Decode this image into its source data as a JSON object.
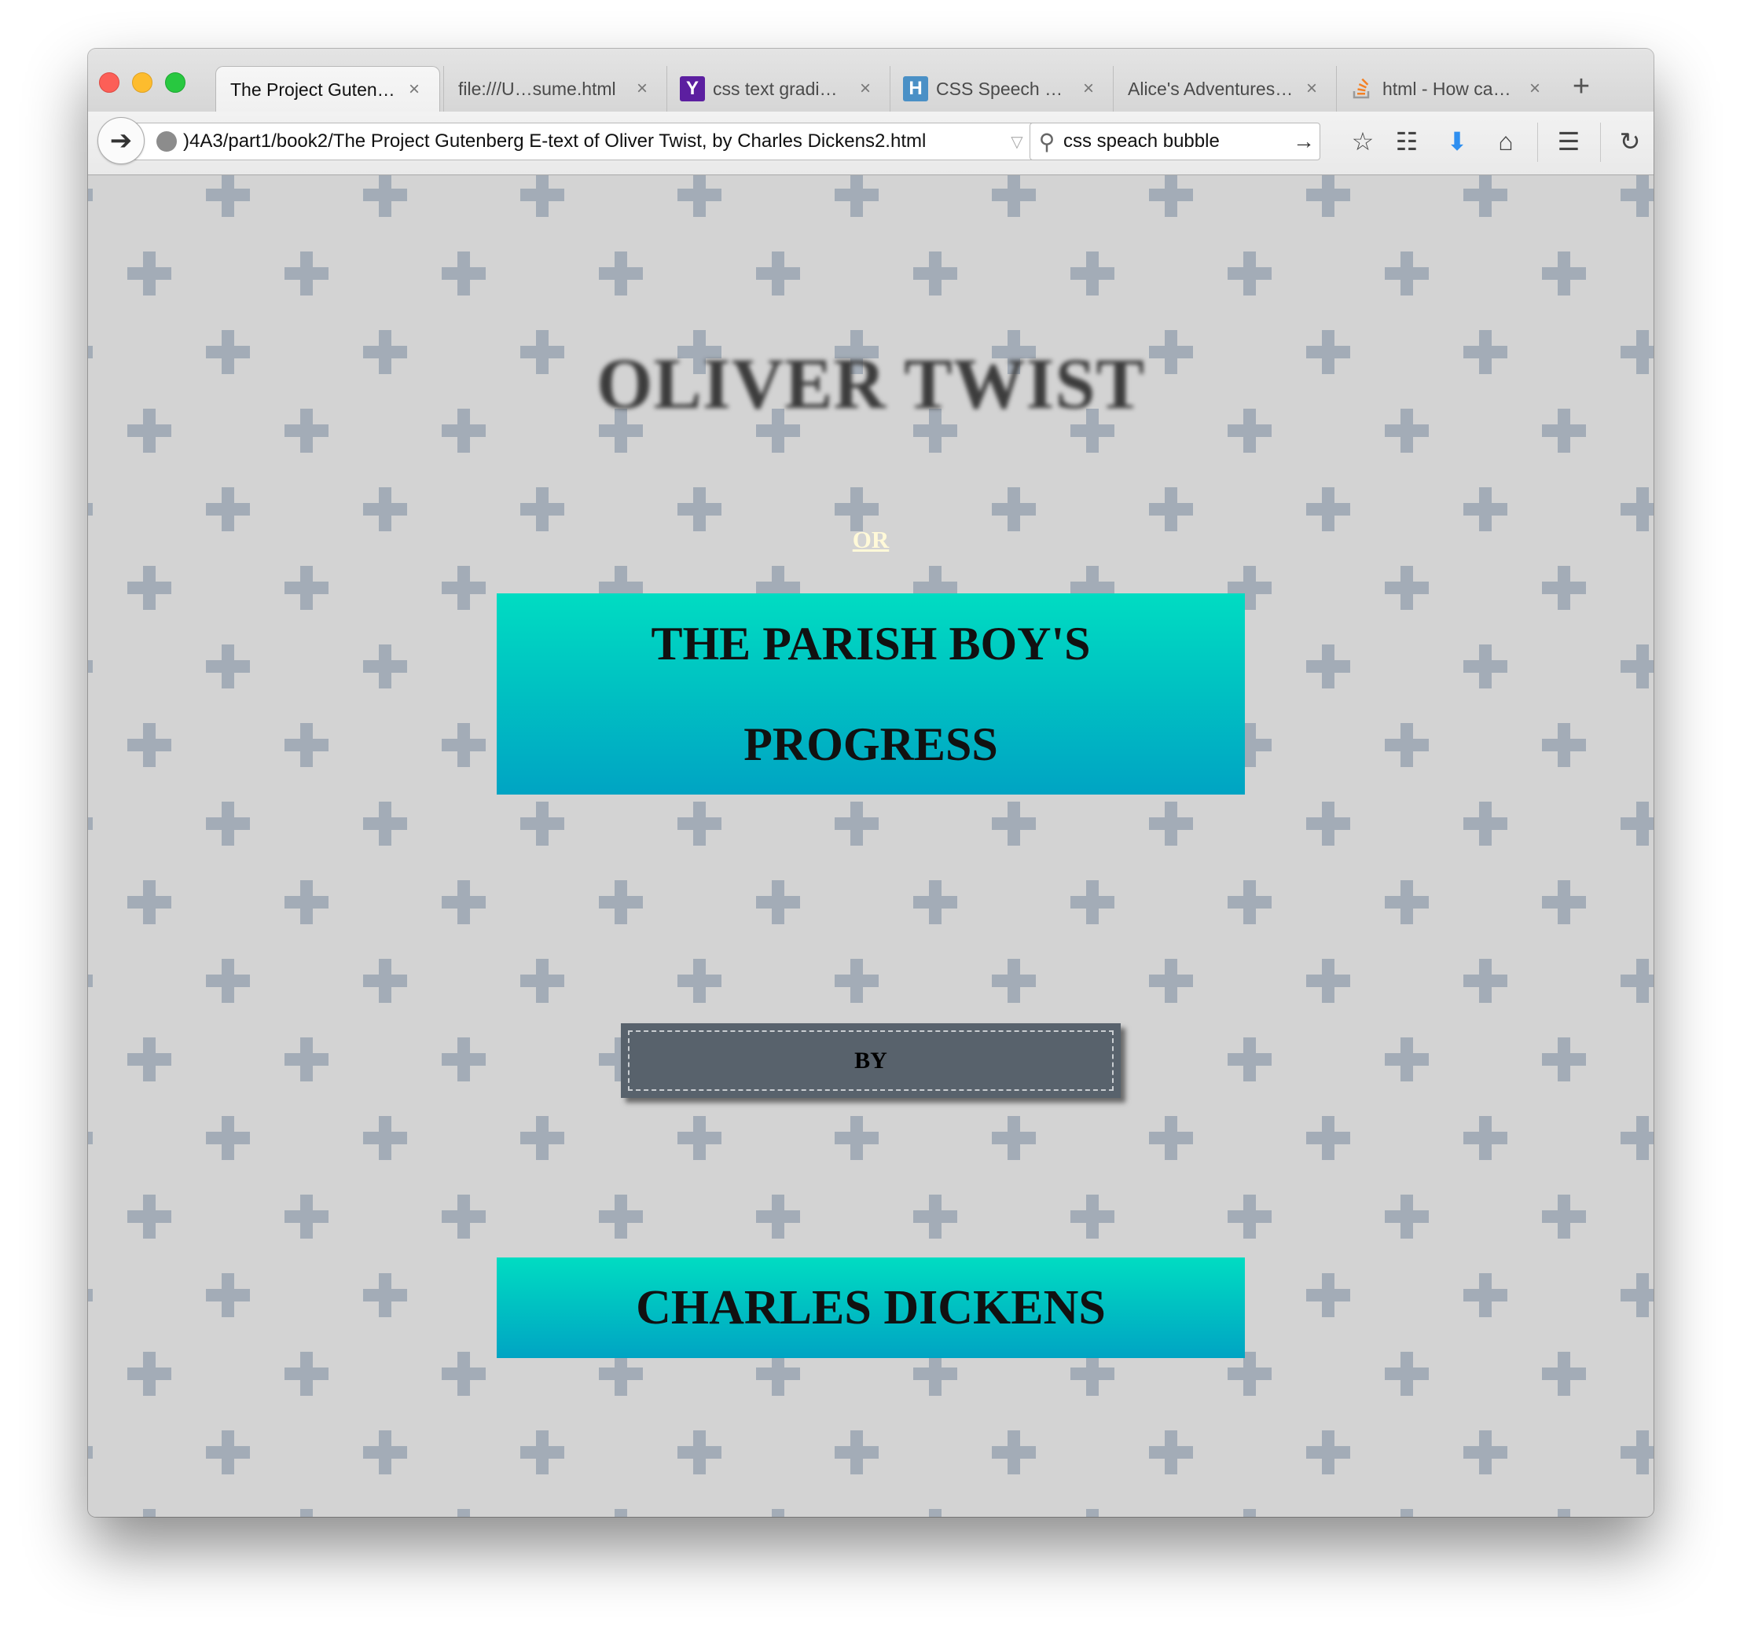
{
  "browser": {
    "tabs": [
      {
        "title": "The Project Guten…",
        "favicon": "",
        "active": true
      },
      {
        "title": "file:///U…sume.html",
        "favicon": "",
        "active": false
      },
      {
        "title": "css text gradi…",
        "favicon": "Y",
        "active": false
      },
      {
        "title": "CSS Speech …",
        "favicon": "H",
        "active": false
      },
      {
        "title": "Alice's Adventures…",
        "favicon": "",
        "active": false
      },
      {
        "title": "html - How ca…",
        "favicon": "stack-icon",
        "active": false
      }
    ],
    "tab_close_glyph": "×",
    "new_tab_glyph": "+",
    "url": ")4A3/part1/book2/The Project Gutenberg E-text of Oliver Twist, by Charles Dickens2.html",
    "search_value": "css speach bubble"
  },
  "page": {
    "title": "OLIVER TWIST",
    "or_text": "OR",
    "subtitle": "THE PARISH BOY'S PROGRESS",
    "by_text": "BY",
    "author": "CHARLES DICKENS"
  },
  "colors": {
    "background": "#d3d3d3",
    "plus_pattern": "#a3acb7",
    "gradient_top": "#00dcc2",
    "gradient_bottom": "#00a4c3",
    "by_box": "#58626c",
    "or_text": "#fff9d8"
  }
}
